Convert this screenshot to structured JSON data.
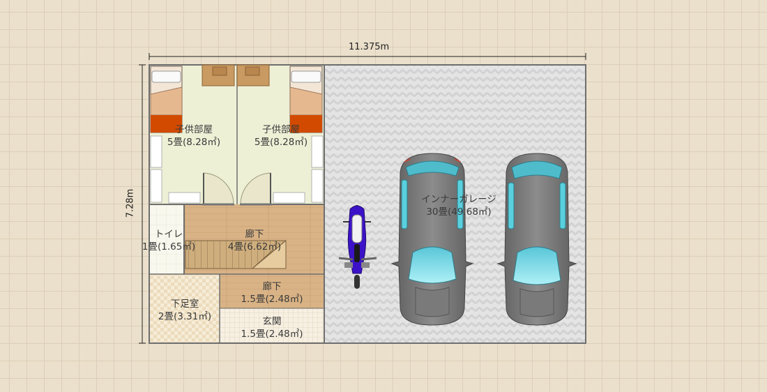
{
  "dimensions": {
    "width": "11.375m",
    "height": "7.28m"
  },
  "rooms": {
    "kids_room_left": {
      "name": "子供部屋",
      "size": "5畳(8.28㎡)"
    },
    "kids_room_right": {
      "name": "子供部屋",
      "size": "5畳(8.28㎡)"
    },
    "garage": {
      "name": "インナーガレージ",
      "size": "30畳(49.68㎡)"
    },
    "toilet": {
      "name": "トイレ",
      "size": "1畳(1.65㎡)"
    },
    "hallway_main": {
      "name": "廊下",
      "size": "4畳(6.62㎡)"
    },
    "hallway_small": {
      "name": "廊下",
      "size": "1.5畳(2.48㎡)"
    },
    "shoe_room": {
      "name": "下足室",
      "size": "2畳(3.31㎡)"
    },
    "entrance": {
      "name": "玄関",
      "size": "1.5畳(2.48㎡)"
    }
  },
  "colors": {
    "kids_room_floor": "#eef0d6",
    "garage_floor": "#e3e3e3",
    "hallway_floor": "#d9b386",
    "wall": "#6e6e6e",
    "car_body": "#7e7e7e",
    "windshield": "#7fdbe8",
    "bike": "#3c12c8"
  }
}
